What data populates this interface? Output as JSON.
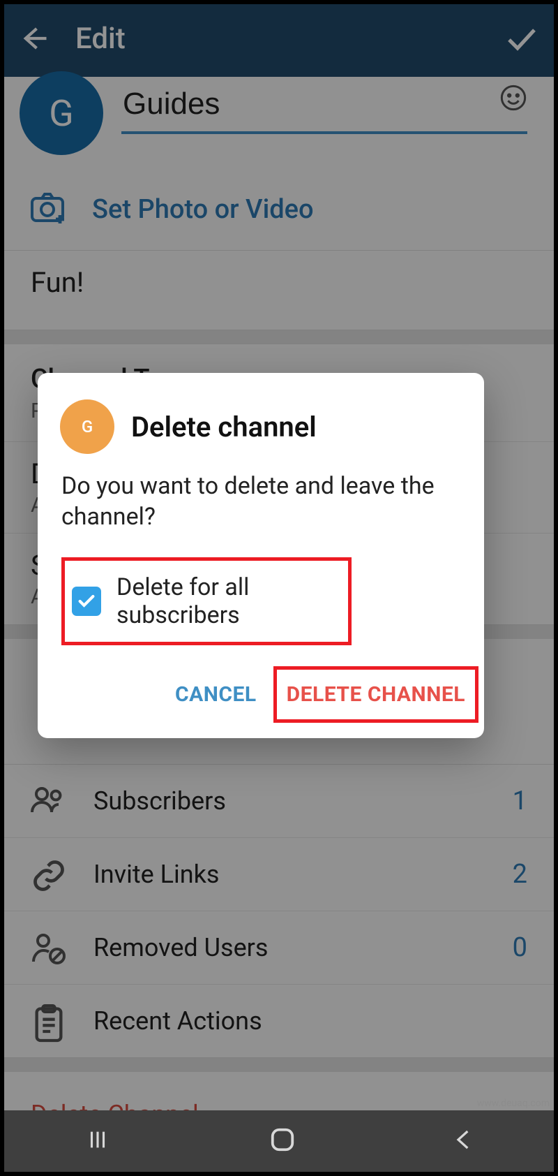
{
  "header": {
    "title": "Edit"
  },
  "channel": {
    "avatar_letter": "G",
    "name_value": "Guides",
    "set_photo_label": "Set Photo or Video",
    "description": "Fun!"
  },
  "type_block": {
    "title": "Channel Type",
    "value": "Private",
    "row2_initial": "D",
    "row2_sub_initial": "A",
    "row3_initial": "S",
    "row3_sub_initial": "A"
  },
  "management": [
    {
      "label": "Subscribers",
      "count": "1",
      "icon": "users"
    },
    {
      "label": "Invite Links",
      "count": "2",
      "icon": "link"
    },
    {
      "label": "Removed Users",
      "count": "0",
      "icon": "user-block"
    },
    {
      "label": "Recent Actions",
      "count": "",
      "icon": "clipboard"
    }
  ],
  "delete_channel_label": "Delete Channel",
  "dialog": {
    "avatar_letter": "G",
    "title": "Delete channel",
    "body": "Do you want to delete and leave the channel?",
    "checkbox_label": "Delete for all subscribers",
    "cancel": "CANCEL",
    "delete": "DELETE CHANNEL"
  },
  "watermark": "www.deuaq.com"
}
